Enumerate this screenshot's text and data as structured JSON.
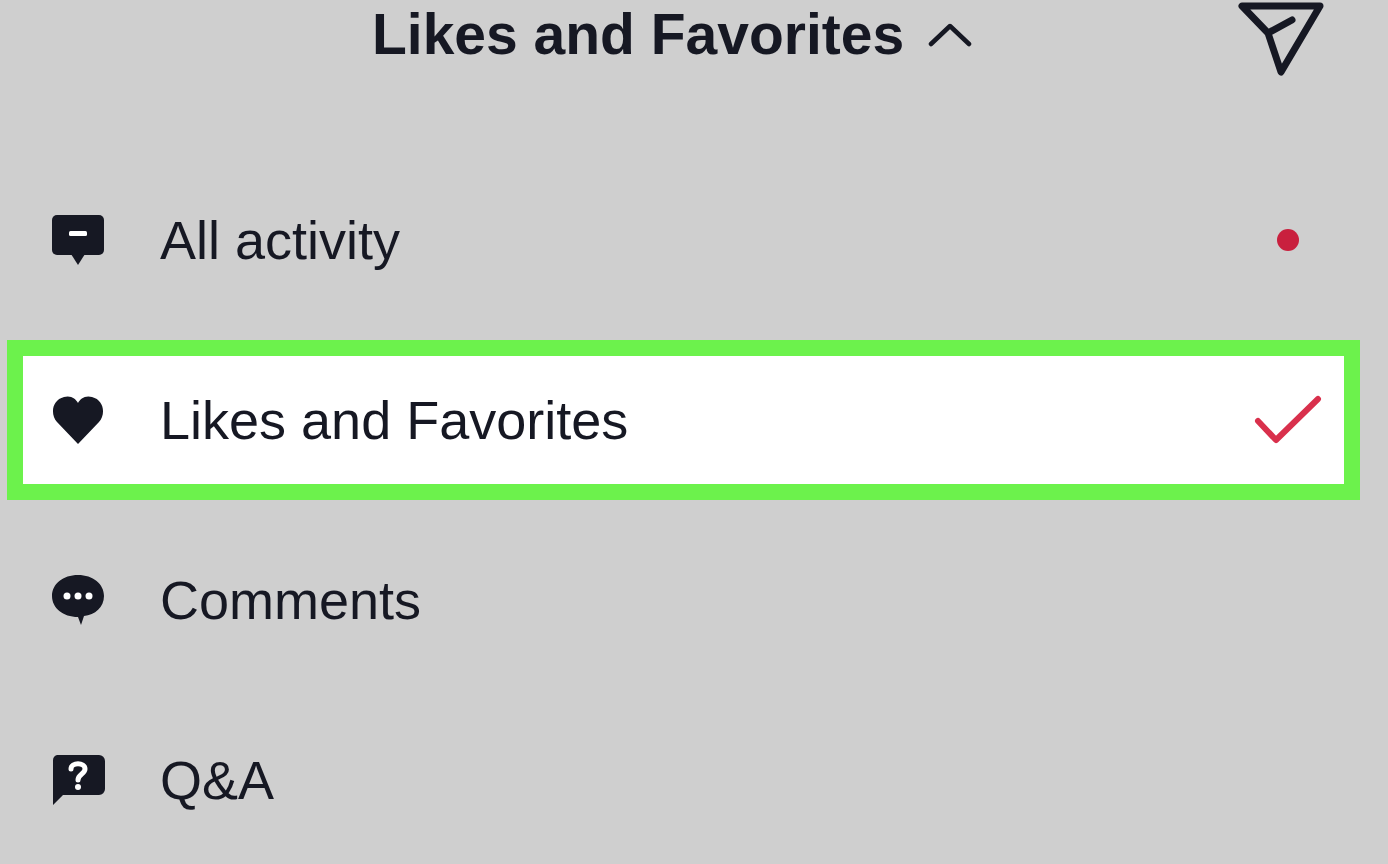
{
  "header": {
    "title": "Likes and Favorites",
    "expanded": true
  },
  "items": [
    {
      "kind": "activity",
      "label": "All activity",
      "selected": false,
      "highlighted": false,
      "unread": true
    },
    {
      "kind": "likes",
      "label": "Likes and Favorites",
      "selected": true,
      "highlighted": true,
      "unread": false
    },
    {
      "kind": "comments",
      "label": "Comments",
      "selected": false,
      "highlighted": false,
      "unread": false
    },
    {
      "kind": "questions",
      "label": "Q&A",
      "selected": false,
      "highlighted": false,
      "unread": false
    }
  ]
}
